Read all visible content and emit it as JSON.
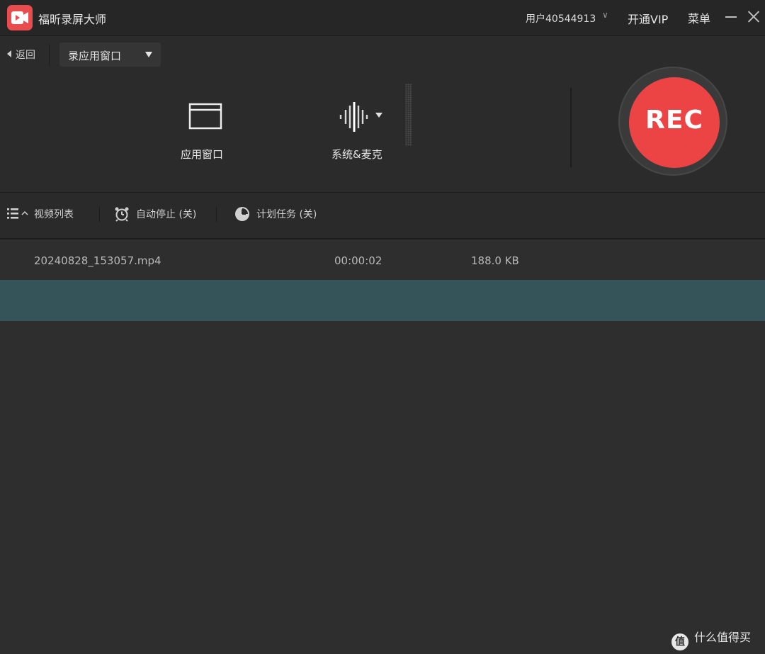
{
  "titlebar": {
    "app_title": "福昕录屏大师",
    "user": "用户40544913",
    "vip": "开通VIP",
    "menu": "菜单"
  },
  "controls": {
    "back": "返回",
    "mode_select": "录应用窗口",
    "window_mode": "应用窗口",
    "audio_mode": "系统&麦克",
    "rec": "REC"
  },
  "toolbar": {
    "video_list": "视频列表",
    "auto_stop": "自动停止 (关)",
    "schedule": "计划任务 (关)"
  },
  "files": [
    {
      "name": "20240828_153057.mp4",
      "duration": "00:00:02",
      "size": "188.0 KB"
    }
  ],
  "colors": {
    "accent": "#ec4444",
    "selected_row": "#35545a",
    "background": "#2e2e2e"
  },
  "watermark": {
    "text": "什么值得买",
    "logo": "值"
  }
}
